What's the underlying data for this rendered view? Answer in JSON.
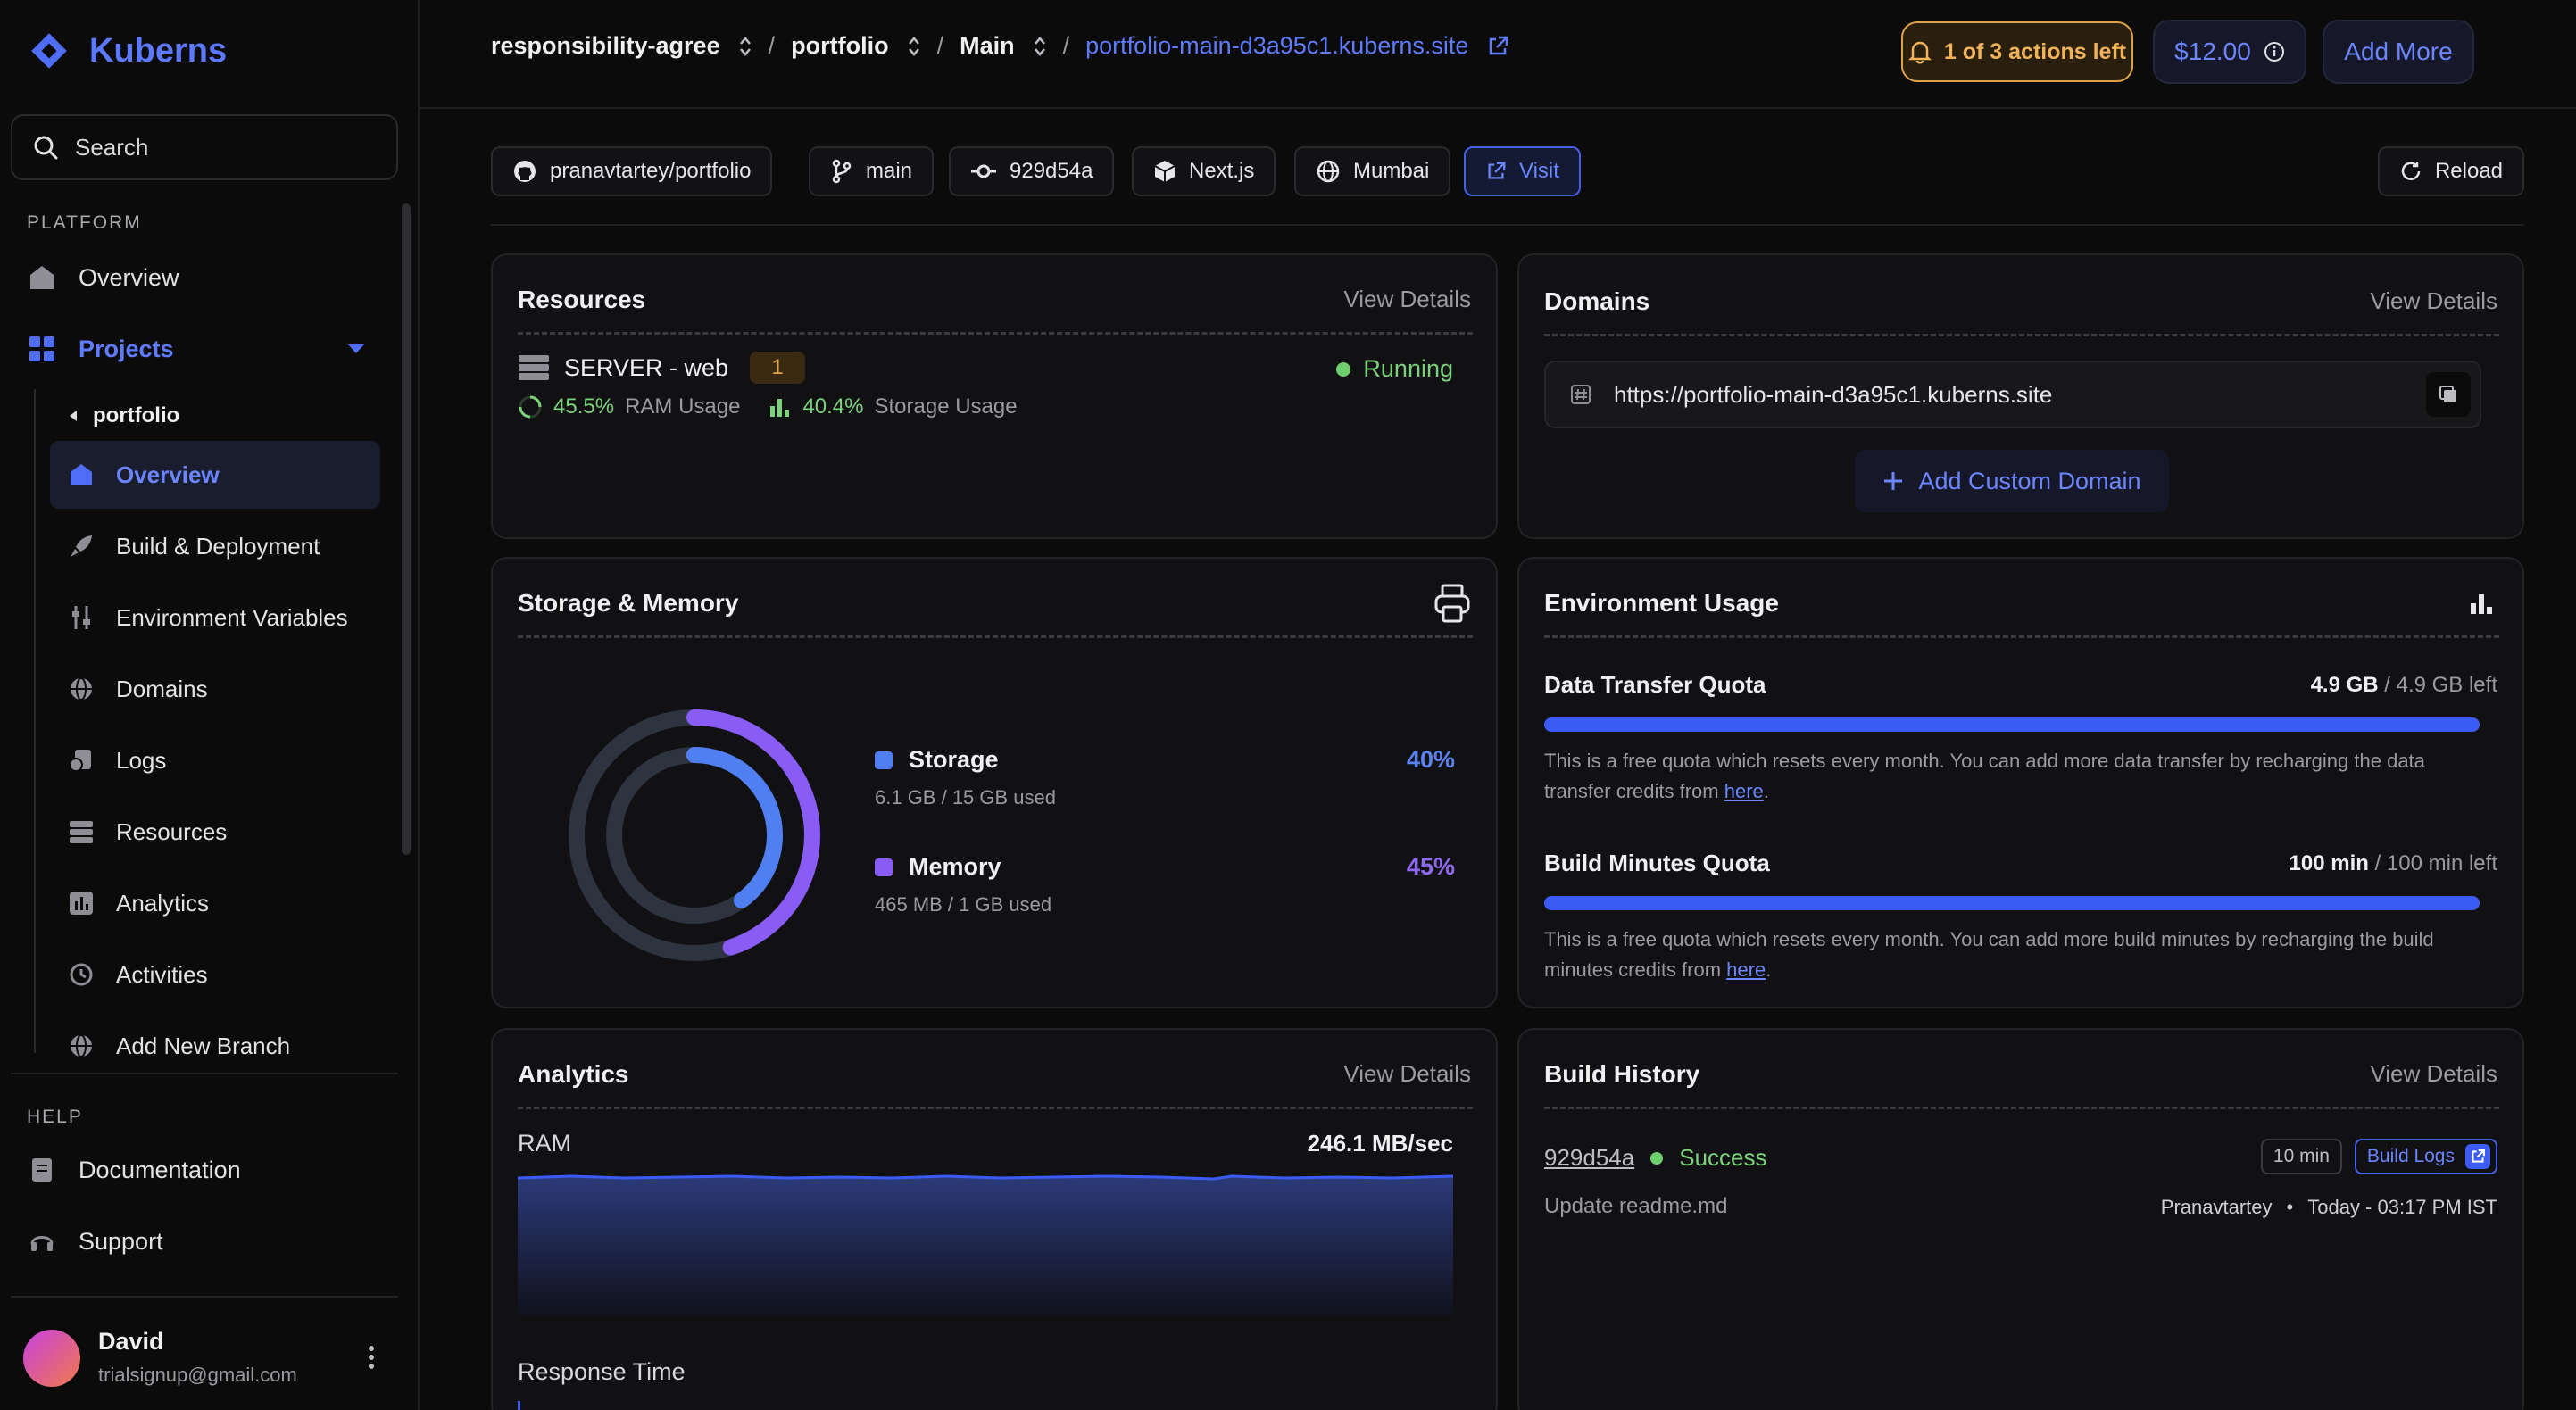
{
  "brand": {
    "name": "Kuberns"
  },
  "sidebar": {
    "search_label": "Search",
    "platform_label": "PLATFORM",
    "overview": "Overview",
    "projects": "Projects",
    "project_name": "portfolio",
    "items": [
      {
        "label": "Overview"
      },
      {
        "label": "Build & Deployment"
      },
      {
        "label": "Environment Variables"
      },
      {
        "label": "Domains"
      },
      {
        "label": "Logs"
      },
      {
        "label": "Resources"
      },
      {
        "label": "Analytics"
      },
      {
        "label": "Activities"
      },
      {
        "label": "Add New Branch"
      }
    ],
    "help_label": "HELP",
    "documentation": "Documentation",
    "support": "Support",
    "user": {
      "name": "David",
      "email": "trialsignup@gmail.com"
    }
  },
  "header": {
    "crumb1": "responsibility-agree",
    "crumb2": "portfolio",
    "crumb3": "Main",
    "crumb_url": "portfolio-main-d3a95c1.kuberns.site",
    "actions_left": "1 of 3 actions left",
    "credit": "$12.00",
    "add_more": "Add More"
  },
  "chips": {
    "repo": "pranavtartey/portfolio",
    "branch": "main",
    "commit": "929d54a",
    "framework": "Next.js",
    "region": "Mumbai",
    "visit": "Visit",
    "reload": "Reload"
  },
  "resources": {
    "title": "Resources",
    "view_details": "View Details",
    "server_name": "SERVER - web",
    "server_count": "1",
    "status": "Running",
    "ram_pct": "45.5%",
    "ram_label": "RAM Usage",
    "storage_pct": "40.4%",
    "storage_label": "Storage Usage"
  },
  "domains": {
    "title": "Domains",
    "view_details": "View Details",
    "url": "https://portfolio-main-d3a95c1.kuberns.site",
    "add_custom": "Add Custom Domain"
  },
  "storage_memory": {
    "title": "Storage & Memory",
    "storage_label": "Storage",
    "storage_detail": "6.1 GB / 15 GB used",
    "storage_pct": "40%",
    "storage_fraction": 0.4,
    "memory_label": "Memory",
    "memory_detail": "465 MB / 1 GB used",
    "memory_pct": "45%",
    "memory_fraction": 0.45,
    "colors": {
      "storage": "#4f7ff0",
      "memory": "#8a5cf6"
    }
  },
  "env_usage": {
    "title": "Environment Usage",
    "transfer_title": "Data Transfer Quota",
    "transfer_value": "4.9 GB",
    "transfer_left": " / 4.9 GB left",
    "transfer_fraction": 1.0,
    "transfer_note": "This is a free quota which resets every month. You can add more data transfer by recharging the data transfer credits from ",
    "build_title": "Build Minutes Quota",
    "build_value": "100 min",
    "build_left": " / 100 min left",
    "build_fraction": 1.0,
    "build_note": "This is a free quota which resets every month. You can add more build minutes by recharging the build minutes credits from ",
    "here": "here",
    "period": "."
  },
  "analytics": {
    "title": "Analytics",
    "view_details": "View Details",
    "ram_label": "RAM",
    "ram_value": "246.1 MB/sec",
    "response_label": "Response Time"
  },
  "build_history": {
    "title": "Build History",
    "view_details": "View Details",
    "commit": "929d54a",
    "status": "Success",
    "duration": "10 min",
    "logs_label": "Build Logs",
    "message": "Update readme.md",
    "author": "Pranavtartey",
    "bullet": "•",
    "time": "Today - 03:17 PM IST"
  }
}
